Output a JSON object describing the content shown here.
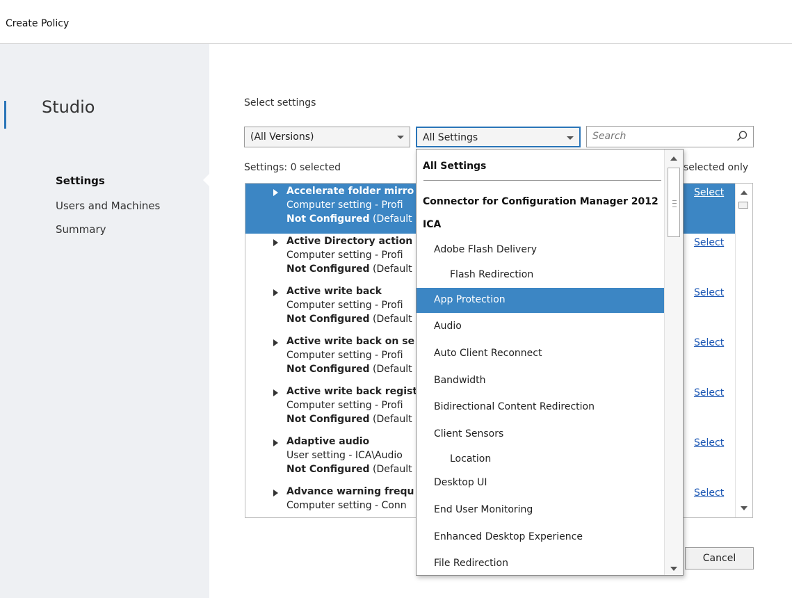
{
  "window": {
    "title": "Create Policy"
  },
  "sidebar": {
    "brand": "Studio",
    "items": [
      {
        "label": "Settings",
        "active": true
      },
      {
        "label": "Users and Machines",
        "active": false
      },
      {
        "label": "Summary",
        "active": false
      }
    ]
  },
  "main": {
    "section_title": "Select settings",
    "version_filter": {
      "value": "(All Versions)"
    },
    "category_filter": {
      "value": "All Settings"
    },
    "search": {
      "placeholder": "Search"
    },
    "count_label": "Settings: 0 selected",
    "selected_only_label": "selected only",
    "settings": [
      {
        "name": "Accelerate folder mirro",
        "scope": "Computer setting - Profi",
        "status": "Not Configured",
        "status_suffix": " (Default",
        "action": "Select",
        "selected": true
      },
      {
        "name": "Active Directory action",
        "scope": "Computer setting - Profi",
        "status": "Not Configured",
        "status_suffix": " (Default",
        "action": "Select",
        "selected": false
      },
      {
        "name": "Active write back",
        "scope": "Computer setting - Profi",
        "status": "Not Configured",
        "status_suffix": " (Default",
        "action": "Select",
        "selected": false
      },
      {
        "name": "Active write back on se",
        "scope": "Computer setting - Profi",
        "status": "Not Configured",
        "status_suffix": " (Default",
        "action": "Select",
        "selected": false
      },
      {
        "name": "Active write back regist",
        "scope": "Computer setting - Profi",
        "status": "Not Configured",
        "status_suffix": " (Default",
        "action": "Select",
        "selected": false
      },
      {
        "name": "Adaptive audio",
        "scope": "User setting - ICA\\Audio",
        "status": "Not Configured",
        "status_suffix": " (Default",
        "action": "Select",
        "selected": false
      },
      {
        "name": "Advance warning frequ",
        "scope": "Computer setting - Conn",
        "status": "",
        "status_suffix": "",
        "action": "Select",
        "selected": false
      }
    ],
    "cancel_label": "Cancel"
  },
  "dropdown": {
    "items": [
      {
        "label": "All Settings",
        "level": 0,
        "header": true
      },
      {
        "label": "Connector for Configuration Manager 2012",
        "level": 0,
        "header": true
      },
      {
        "label": "ICA",
        "level": 0,
        "header": true
      },
      {
        "label": "Adobe Flash Delivery",
        "level": 1,
        "header": false
      },
      {
        "label": "Flash Redirection",
        "level": 2,
        "header": false
      },
      {
        "label": "App Protection",
        "level": 1,
        "header": false,
        "highlighted": true
      },
      {
        "label": "Audio",
        "level": 1,
        "header": false
      },
      {
        "label": "Auto Client Reconnect",
        "level": 1,
        "header": false
      },
      {
        "label": "Bandwidth",
        "level": 1,
        "header": false
      },
      {
        "label": "Bidirectional Content Redirection",
        "level": 1,
        "header": false
      },
      {
        "label": "Client Sensors",
        "level": 1,
        "header": false
      },
      {
        "label": "Location",
        "level": 2,
        "header": false
      },
      {
        "label": "Desktop UI",
        "level": 1,
        "header": false
      },
      {
        "label": "End User Monitoring",
        "level": 1,
        "header": false
      },
      {
        "label": "Enhanced Desktop Experience",
        "level": 1,
        "header": false
      },
      {
        "label": "File Redirection",
        "level": 1,
        "header": false
      }
    ]
  },
  "colors": {
    "accent": "#3c86c4",
    "link": "#1a56b4"
  },
  "icons": {
    "search": "magnifier-icon",
    "expand": "triangle-right-icon"
  }
}
